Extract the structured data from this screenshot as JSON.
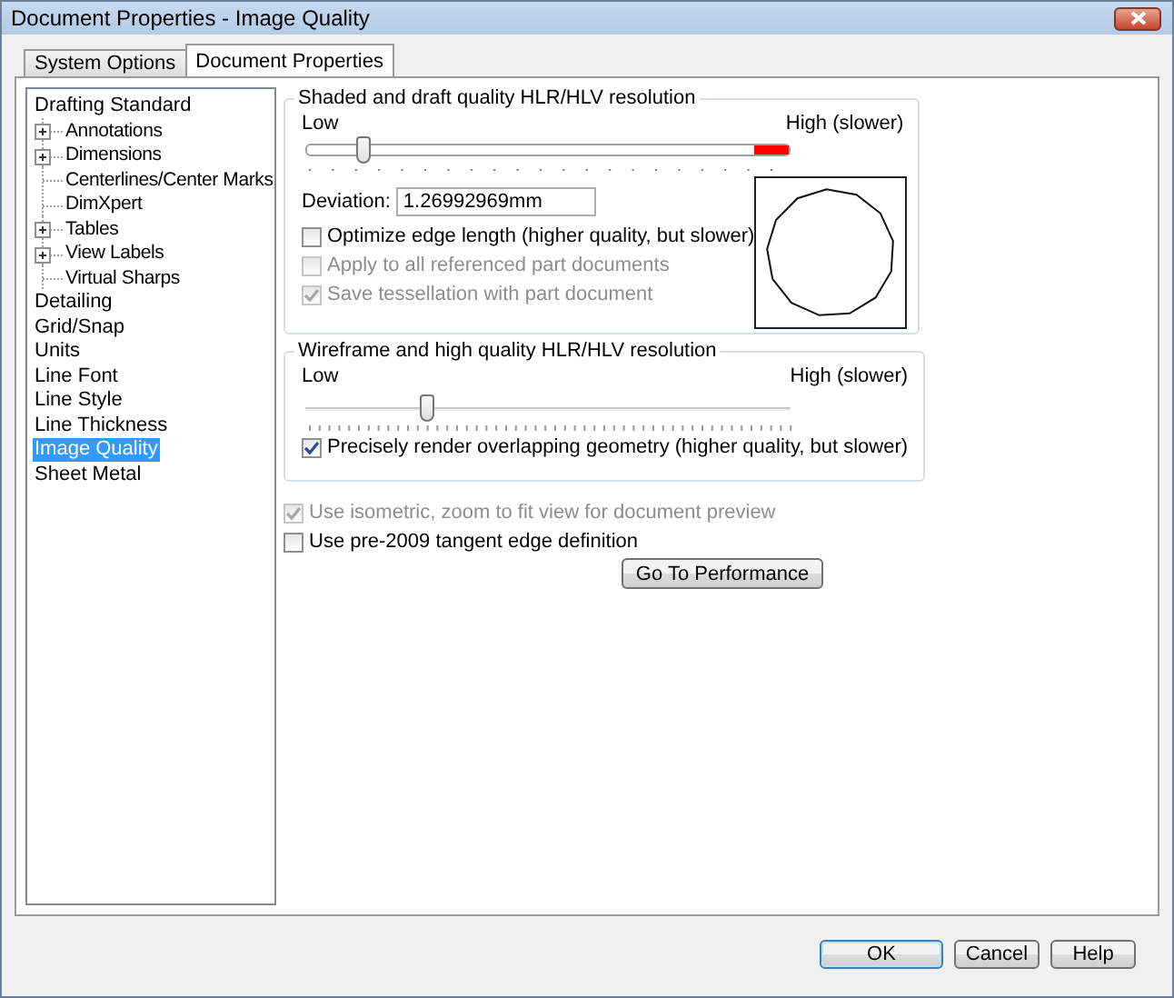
{
  "window": {
    "title": "Document Properties - Image Quality"
  },
  "tabs": [
    {
      "label": "System Options",
      "selected": false
    },
    {
      "label": "Document Properties",
      "selected": true
    }
  ],
  "tree": [
    {
      "label": "Drafting Standard",
      "selected": false,
      "children": [
        {
          "label": "Annotations",
          "kind": "collapsed"
        },
        {
          "label": "Dimensions",
          "kind": "collapsed"
        },
        {
          "label": "Centerlines/Center Marks",
          "kind": "leaf"
        },
        {
          "label": "DimXpert",
          "kind": "leaf"
        },
        {
          "label": "Tables",
          "kind": "collapsed"
        },
        {
          "label": "View Labels",
          "kind": "collapsed"
        },
        {
          "label": "Virtual Sharps",
          "kind": "leaf"
        }
      ]
    },
    {
      "label": "Detailing",
      "selected": false
    },
    {
      "label": "Grid/Snap",
      "selected": false
    },
    {
      "label": "Units",
      "selected": false
    },
    {
      "label": "Line Font",
      "selected": false
    },
    {
      "label": "Line Style",
      "selected": false
    },
    {
      "label": "Line Thickness",
      "selected": false
    },
    {
      "label": "Image Quality",
      "selected": true
    },
    {
      "label": "Sheet Metal",
      "selected": false
    }
  ],
  "shaded_group": {
    "title": "Shaded and draft quality HLR/HLV resolution",
    "slider": {
      "low_label": "Low",
      "high_label": "High (slower)",
      "level": 0.12,
      "warning_zone": true
    },
    "deviation_label": "Deviation:",
    "deviation_value": "1.26992969mm",
    "checkboxes": [
      {
        "label": "Optimize edge length (higher quality, but slower)",
        "checked": false,
        "disabled": false
      },
      {
        "label": "Apply to all referenced part documents",
        "checked": false,
        "disabled": true
      },
      {
        "label": "Save tessellation with part document",
        "checked": true,
        "disabled": true
      }
    ]
  },
  "wireframe_group": {
    "title": "Wireframe and high quality HLR/HLV resolution",
    "slider": {
      "low_label": "Low",
      "high_label": "High (slower)",
      "level": 0.25,
      "warning_zone": false
    },
    "checkboxes": [
      {
        "label": "Precisely render overlapping geometry (higher quality, but slower)",
        "checked": true,
        "disabled": false
      }
    ]
  },
  "options": [
    {
      "label": "Use isometric, zoom to fit view for document preview",
      "checked": true,
      "disabled": true
    },
    {
      "label": "Use pre-2009 tangent edge definition",
      "checked": false,
      "disabled": false
    }
  ],
  "performance_button": "Go To Performance",
  "buttons": [
    {
      "label": "OK",
      "default": true
    },
    {
      "label": "Cancel",
      "default": false
    },
    {
      "label": "Help",
      "default": false
    }
  ]
}
